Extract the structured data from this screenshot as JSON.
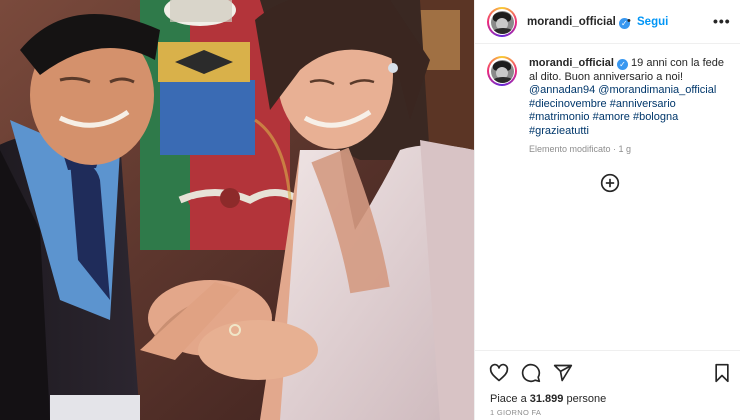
{
  "post": {
    "username": "morandi_official",
    "verified": true,
    "separator": "•",
    "follow_label": "Segui",
    "more_label": "•••",
    "photo_icon": "wedding-ring-photo",
    "caption": {
      "username": "morandi_official",
      "text_1": "19 anni con la fede al dito. Buon anniversario a noi!",
      "mentions": [
        "@annadan94",
        "@morandimania_official"
      ],
      "hashtags": [
        "#diecinovembre",
        "#anniversario",
        "#matrimonio",
        "#amore",
        "#bologna",
        "#grazieatutti"
      ],
      "meta": "Elemento modificato · 1 g"
    },
    "likes_prefix": "Piace a",
    "likes_count": "31.899",
    "likes_suffix": "persone",
    "date": "1 GIORNO FA",
    "icons": {
      "like": "heart-icon",
      "comment": "comment-icon",
      "share": "share-icon",
      "save": "bookmark-icon",
      "add": "add-circle-icon"
    },
    "colors": {
      "link": "#00376b",
      "follow": "#0095f6",
      "verified": "#3897f0",
      "meta": "#8e8e8e"
    }
  }
}
